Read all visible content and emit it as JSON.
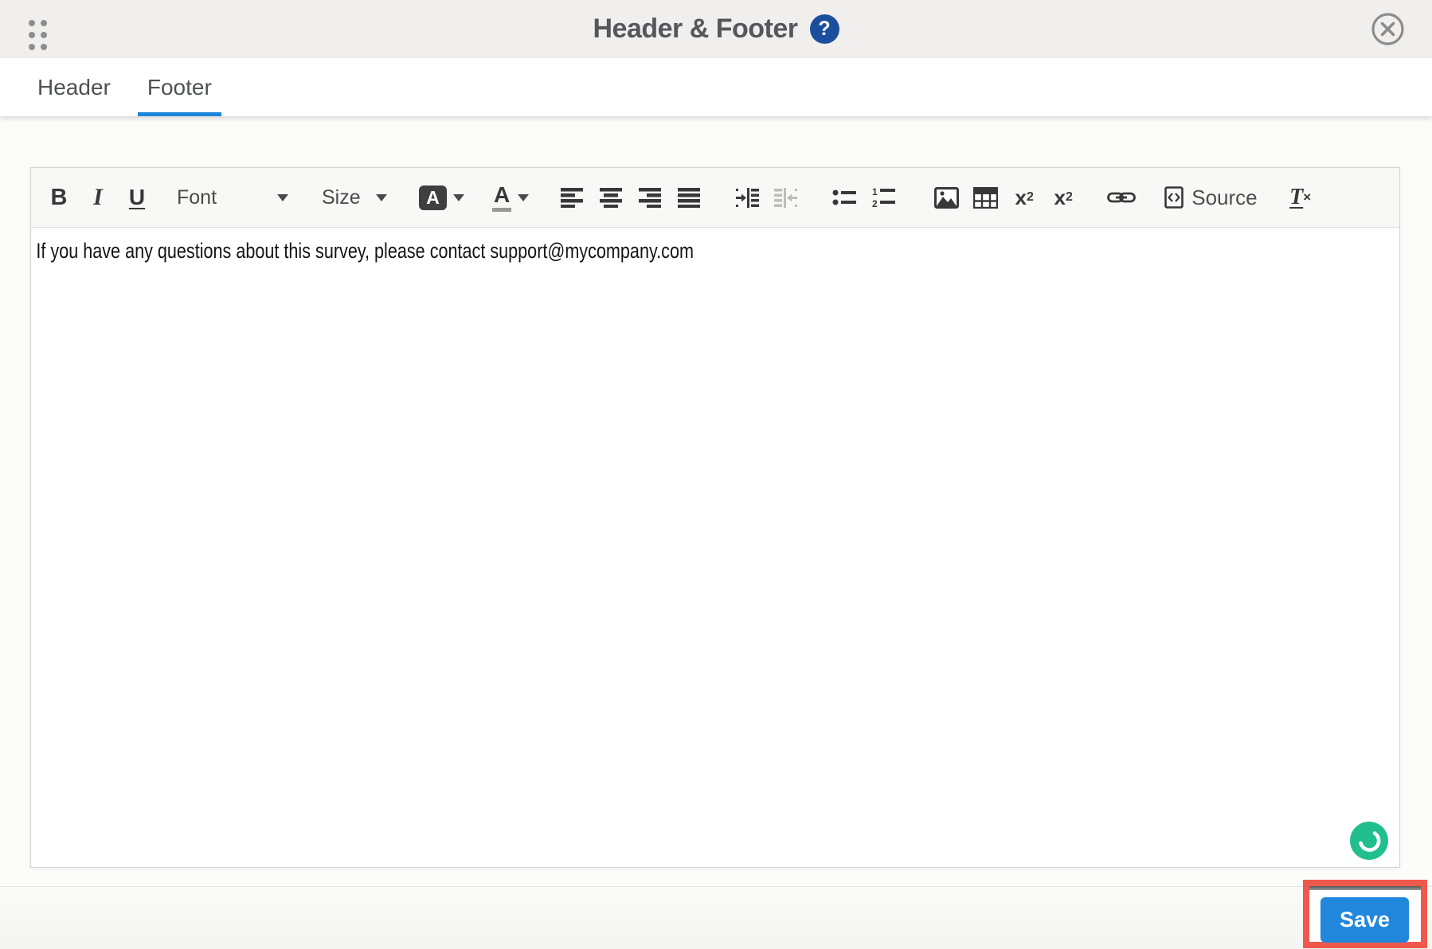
{
  "header": {
    "title": "Header & Footer",
    "help_glyph": "?"
  },
  "tabs": {
    "items": [
      {
        "label": "Header",
        "active": false
      },
      {
        "label": "Footer",
        "active": true
      }
    ]
  },
  "toolbar": {
    "bold": "B",
    "italic": "I",
    "underline": "U",
    "font_label": "Font",
    "size_label": "Size",
    "bgcolor_letter": "A",
    "textcolor_letter": "A",
    "numbered_1": "1",
    "numbered_2": "2",
    "subscript_base": "x",
    "subscript_small": "2",
    "superscript_base": "x",
    "superscript_small": "2",
    "source_label": "Source",
    "removeformat_letter": "T",
    "removeformat_x": "×"
  },
  "editor": {
    "content": "If you have any questions about this survey, please contact support@mycompany.com"
  },
  "footer": {
    "save_label": "Save"
  },
  "colors": {
    "accent_blue": "#1e87d8",
    "save_button_blue": "#2187dd",
    "annotation_red": "#ee594c",
    "help_icon_navy": "#1b4f9e",
    "widget_green": "#21bf8d",
    "topbar_gray": "#f0efee"
  }
}
